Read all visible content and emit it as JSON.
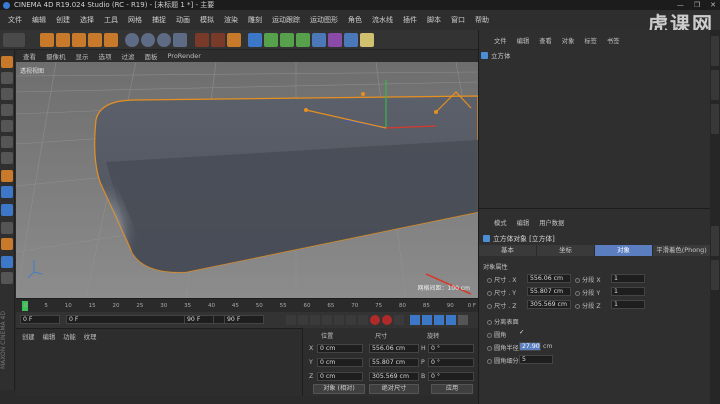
{
  "window": {
    "title": "CINEMA 4D R19.024 Studio (RC - R19) - [未标题 1 *] - 主要",
    "controls": [
      "—",
      "❐",
      "✕"
    ]
  },
  "brand": "虎课网",
  "menu": [
    "文件",
    "编辑",
    "创建",
    "选择",
    "工具",
    "网格",
    "捕捉",
    "动画",
    "模拟",
    "渲染",
    "雕刻",
    "运动跟踪",
    "运动图形",
    "角色",
    "流水线",
    "插件",
    "脚本",
    "窗口",
    "帮助"
  ],
  "viewport_menu": [
    "查看",
    "摄像机",
    "显示",
    "选项",
    "过滤",
    "面板",
    "ProRender"
  ],
  "viewport": {
    "label": "透视视图",
    "grid_text": "网格间距：100 cm"
  },
  "timeline": {
    "ticks": [
      "0",
      "5",
      "10",
      "15",
      "20",
      "25",
      "30",
      "35",
      "40",
      "45",
      "50",
      "55",
      "60",
      "65",
      "70",
      "75",
      "80",
      "85",
      "90"
    ],
    "end": "0 F"
  },
  "playbar": {
    "start": "0 F",
    "current": "0 F",
    "frame_end": "90 F",
    "end": "90 F"
  },
  "material_menu": [
    "创建",
    "编辑",
    "功能",
    "纹理"
  ],
  "coords": {
    "headers": [
      "位置",
      "尺寸",
      "旋转"
    ],
    "rows": [
      {
        "axis": "X",
        "pos": "0 cm",
        "size": "556.06 cm",
        "rot_label": "H",
        "rot": "0 °"
      },
      {
        "axis": "Y",
        "pos": "0 cm",
        "size": "55.807 cm",
        "rot_label": "P",
        "rot": "0 °"
      },
      {
        "axis": "Z",
        "pos": "0 cm",
        "size": "305.569 cm",
        "rot_label": "B",
        "rot": "0 °"
      }
    ],
    "mode_select": "对象 (相对)",
    "size_select": "绝对尺寸",
    "apply": "应用"
  },
  "objects_panel": {
    "tabs": [
      "文件",
      "编辑",
      "查看",
      "对象",
      "标签",
      "书签"
    ],
    "object_name": "立方体"
  },
  "attributes": {
    "menu": [
      "模式",
      "编辑",
      "用户数据"
    ],
    "title": "立方体对象 [立方体]",
    "tabs": [
      "基本",
      "坐标",
      "对象",
      "平滑着色(Phong)"
    ],
    "active_tab": "对象",
    "section": "对象属性",
    "size_rows": [
      {
        "label": "尺寸 . X",
        "value": "556.06 cm",
        "seg_label": "分段 X",
        "seg": "1"
      },
      {
        "label": "尺寸 . Y",
        "value": "55.807 cm",
        "seg_label": "分段 Y",
        "seg": "1"
      },
      {
        "label": "尺寸 . Z",
        "value": "305.569 cm",
        "seg_label": "分段 Z",
        "seg": "1"
      }
    ],
    "separate": "分离表面",
    "fillet_label": "圆角",
    "fillet_check": "✓",
    "fillet_radius_label": "圆角半径",
    "fillet_radius": "27.903",
    "fillet_radius_unit": "cm",
    "fillet_sub_label": "圆角细分",
    "fillet_sub": "5"
  },
  "left_vertical_text": "MAXON CINEMA 4D",
  "colors": {
    "accent": "#5a7ec0",
    "object_outline": "#e8901e",
    "arrow": "#e03020"
  }
}
